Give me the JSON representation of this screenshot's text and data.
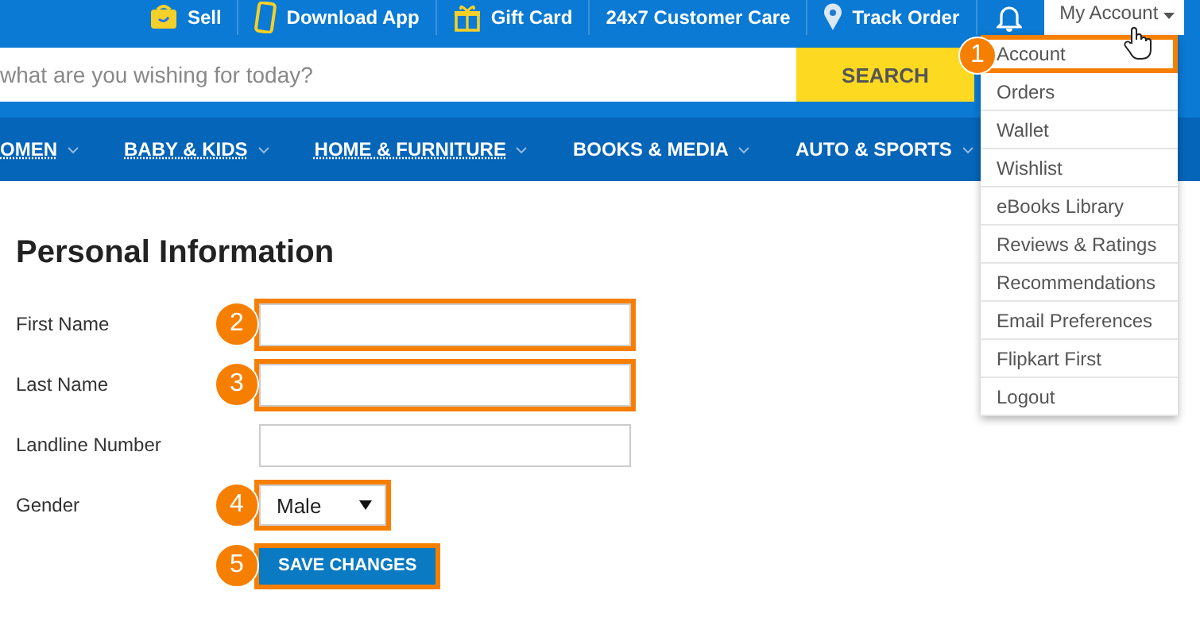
{
  "top_bar": {
    "links": [
      {
        "kind": "sell",
        "label": "Sell"
      },
      {
        "kind": "phone",
        "label": "Download App"
      },
      {
        "kind": "gift",
        "label": "Gift Card"
      },
      {
        "kind": "none",
        "label": "24x7 Customer Care"
      },
      {
        "kind": "pin",
        "label": "Track Order"
      },
      {
        "kind": "bell"
      }
    ]
  },
  "account_menu": {
    "label": "My Account",
    "items": [
      {
        "label": "Account",
        "highlighted": true,
        "marker": "1"
      },
      {
        "label": "Orders",
        "highlighted": false
      },
      {
        "label": "Wallet",
        "highlighted": false
      },
      {
        "label": "Wishlist",
        "highlighted": false
      },
      {
        "label": "eBooks Library",
        "highlighted": false
      },
      {
        "label": "Reviews & Ratings",
        "highlighted": false
      },
      {
        "label": "Recommendations",
        "highlighted": false
      },
      {
        "label": "Email Preferences",
        "highlighted": false
      },
      {
        "label": "Flipkart First",
        "highlighted": false
      },
      {
        "label": "Logout",
        "highlighted": false
      }
    ]
  },
  "search": {
    "placeholder": "what are you wishing for today?",
    "button": "SEARCH"
  },
  "nav": [
    {
      "label": "OMEN",
      "underlined": true
    },
    {
      "label": "BABY & KIDS",
      "underlined": true
    },
    {
      "label": "HOME & FURNITURE",
      "underlined": true
    },
    {
      "label": "BOOKS & MEDIA",
      "underlined": false
    },
    {
      "label": "AUTO & SPORTS",
      "underlined": false
    }
  ],
  "form": {
    "title": "Personal Information",
    "fields": [
      {
        "kind": "text",
        "label": "First Name",
        "highlighted": true,
        "marker": "2"
      },
      {
        "kind": "text",
        "label": "Last Name",
        "highlighted": true,
        "marker": "3"
      },
      {
        "kind": "text",
        "label": "Landline Number",
        "highlighted": false
      },
      {
        "kind": "select",
        "label": "Gender",
        "value": "Male",
        "highlighted": true,
        "marker": "4"
      }
    ],
    "save_button": {
      "label": "SAVE CHANGES",
      "highlighted": true,
      "marker": "5"
    }
  }
}
